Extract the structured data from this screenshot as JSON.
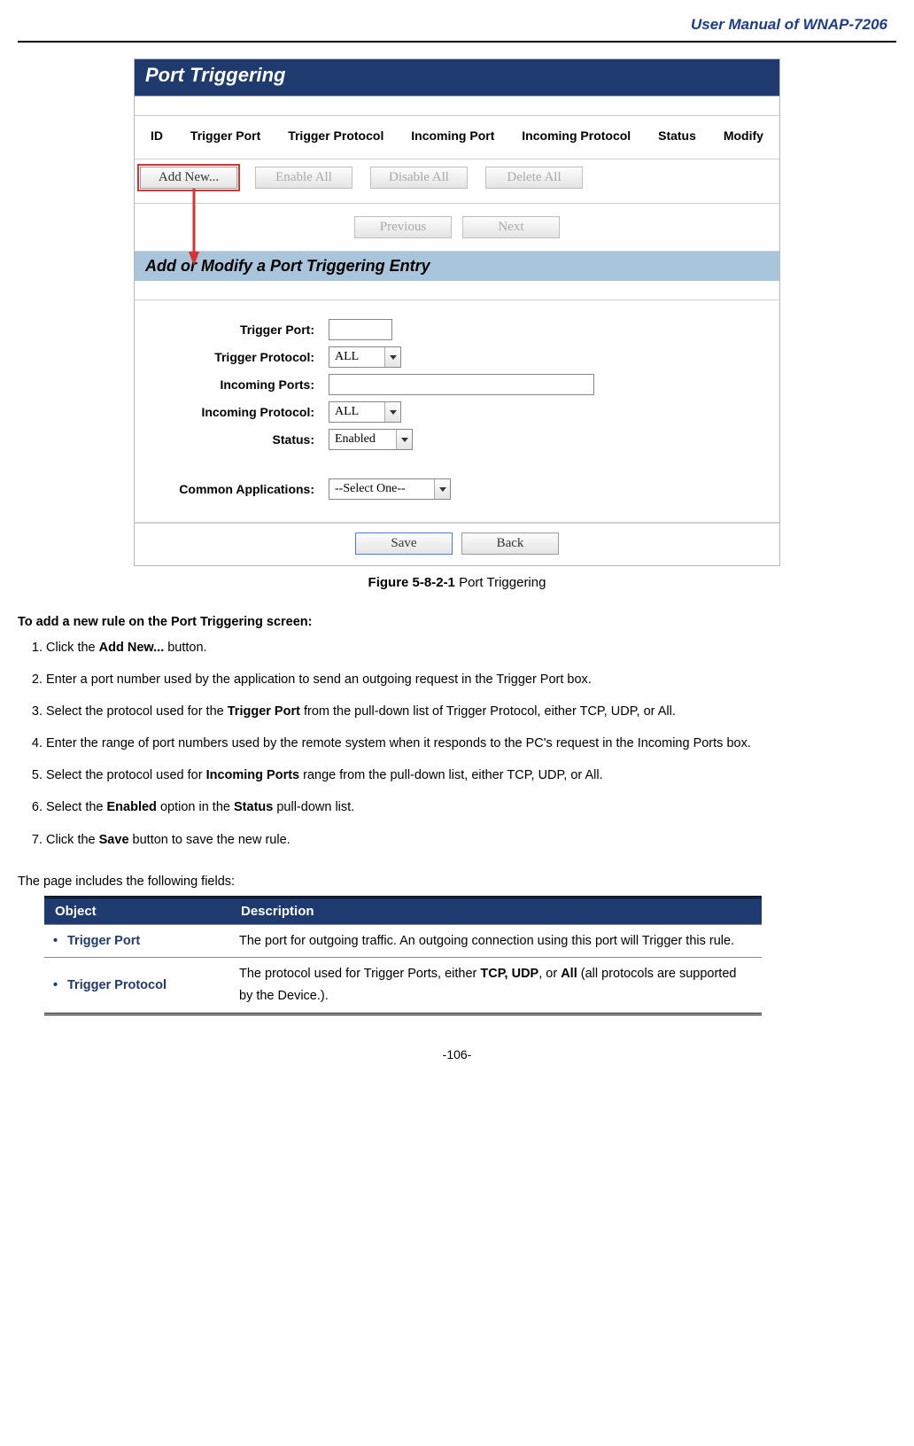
{
  "header": {
    "doc_title": "User Manual of WNAP-7206"
  },
  "screenshot": {
    "banner1": "Port Triggering",
    "cols": [
      "ID",
      "Trigger Port",
      "Trigger Protocol",
      "Incoming Port",
      "Incoming Protocol",
      "Status",
      "Modify"
    ],
    "buttons": {
      "add_new": "Add New...",
      "enable_all": "Enable All",
      "disable_all": "Disable All",
      "delete_all": "Delete All",
      "previous": "Previous",
      "next": "Next",
      "save": "Save",
      "back": "Back"
    },
    "banner2": "Add or Modify a Port Triggering Entry",
    "form": {
      "trigger_port_label": "Trigger Port:",
      "trigger_protocol_label": "Trigger Protocol:",
      "incoming_ports_label": "Incoming Ports:",
      "incoming_protocol_label": "Incoming Protocol:",
      "status_label": "Status:",
      "common_apps_label": "Common Applications:",
      "protocol_value": "ALL",
      "status_value": "Enabled",
      "common_apps_value": "--Select One--"
    }
  },
  "figure_caption_bold": "Figure 5-8-2-1",
  "figure_caption_rest": " Port Triggering",
  "instructions_heading": "To add a new rule on the Port Triggering screen:",
  "steps": [
    {
      "pre": "Click the ",
      "b1": "Add New...",
      "post": " button."
    },
    {
      "pre": "Enter a port number used by the application to send an outgoing request in the Trigger Port box.",
      "b1": "",
      "post": ""
    },
    {
      "pre": "Select the protocol used for the ",
      "b1": "Trigger Port",
      "post": " from the pull-down list of Trigger Protocol, either TCP, UDP, or All."
    },
    {
      "pre": "Enter the range of port numbers used by the remote system when it responds to the PC's request in the Incoming Ports box.",
      "b1": "",
      "post": ""
    },
    {
      "pre": "Select the protocol used for ",
      "b1": "Incoming Ports",
      "post": " range from the pull-down list, either TCP, UDP, or All."
    },
    {
      "pre": "Select the ",
      "b1": "Enabled",
      "mid": " option in the ",
      "b2": "Status",
      "post": " pull-down list."
    },
    {
      "pre": "Click the ",
      "b1": "Save",
      "post": " button to save the new rule."
    }
  ],
  "fields_intro": "The page includes the following fields:",
  "fields_table": {
    "headers": [
      "Object",
      "Description"
    ],
    "rows": [
      {
        "obj": "Trigger Port",
        "desc_pre": "The port for outgoing traffic. An outgoing connection using this port will Trigger this rule.",
        "b1": "",
        "desc_post": ""
      },
      {
        "obj": "Trigger Protocol",
        "desc_pre": "The protocol used for Trigger Ports, either ",
        "b1": "TCP, UDP",
        "mid": ", or ",
        "b2": "All",
        "desc_post": " (all protocols are supported by the Device.)."
      }
    ]
  },
  "page_number": "-106-"
}
